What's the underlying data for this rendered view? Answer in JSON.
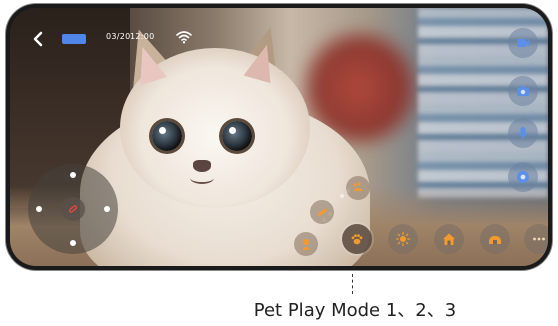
{
  "status_bar": {
    "date": "03/20",
    "time": "12:00",
    "back_icon": "chevron-left-icon",
    "wifi_icon": "wifi-icon"
  },
  "side_controls": [
    {
      "icon": "video-record-icon"
    },
    {
      "icon": "camera-icon"
    },
    {
      "icon": "microphone-icon"
    },
    {
      "icon": "settings-icon"
    }
  ],
  "bottom_controls": [
    {
      "icon": "paw-icon"
    },
    {
      "icon": "light-icon"
    },
    {
      "icon": "home-icon"
    },
    {
      "icon": "house-low-icon"
    },
    {
      "icon": "more-icon"
    }
  ],
  "play_modes": [
    {
      "icon": "play-mode-1-icon"
    },
    {
      "icon": "play-mode-2-icon"
    },
    {
      "icon": "play-mode-3-icon"
    }
  ],
  "annotation": {
    "label": "Pet Play Mode 1、2、3"
  },
  "colors": {
    "accent": "#4f86e8",
    "orange": "#f39a2e",
    "joystick_red": "#e0483f"
  }
}
